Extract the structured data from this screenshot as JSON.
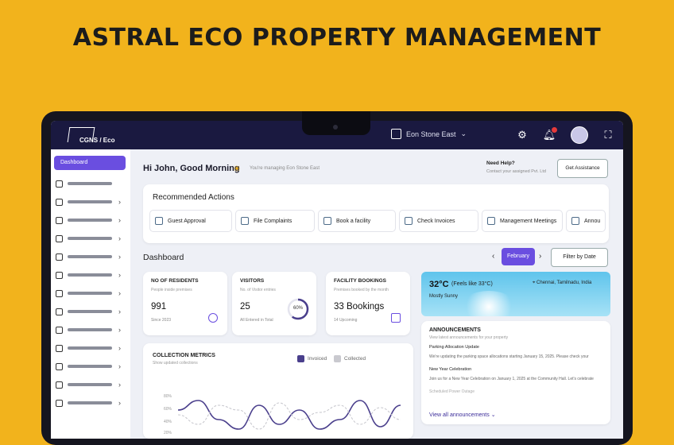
{
  "headline": "ASTRAL ECO PROPERTY MANAGEMENT",
  "brand": {
    "logo_text": "CGNS / Eco"
  },
  "topbar": {
    "property": "Eon Stone East",
    "icons": [
      "settings-icon",
      "bell-icon",
      "avatar",
      "fullscreen-icon"
    ]
  },
  "sidebar": {
    "active": "Dashboard",
    "items": [
      "home-icon",
      "building-icon",
      "users-icon",
      "globe-icon",
      "card-icon",
      "wallet-icon",
      "tag-icon",
      "cycle-icon",
      "document-icon",
      "book-icon",
      "share-icon",
      "gear-icon"
    ]
  },
  "greeting": {
    "title": "Hi John, Good Morning",
    "subtitle": "You're managing Eon Stone East"
  },
  "help": {
    "title": "Need Help?",
    "subtitle": "Contact your assigned Pvt. Ltd",
    "button": "Get Assistance"
  },
  "recommended": {
    "title": "Recommended Actions",
    "actions": [
      "Guest Approval",
      "File Complaints",
      "Book a facility",
      "Check Invoices",
      "Management Meetings",
      "Annou"
    ]
  },
  "dashboard": {
    "title": "Dashboard",
    "month": "February",
    "filter": "Filter by Date"
  },
  "stats": [
    {
      "title": "NO OF RESIDENTS",
      "subtitle": "People inside premises",
      "value": "991",
      "footer": "Since 2023"
    },
    {
      "title": "VISITORS",
      "subtitle": "No. of Visitor entries",
      "value": "25",
      "footer": "All Entered in Total",
      "ring": "60%"
    },
    {
      "title": "FACILITY BOOKINGS",
      "subtitle": "Premises booked by the month",
      "value": "33 Bookings",
      "footer": "14 Upcoming"
    }
  ],
  "weather": {
    "temp": "32°C",
    "feels": "(Feels like 33°C)",
    "location": "Chennai, Tamilnadu, India",
    "condition": "Mostly Sunny"
  },
  "announcements": {
    "title": "ANNOUNCEMENTS",
    "subtitle": "View latest announcements for your property",
    "items": [
      {
        "title": "Parking Allocation Update",
        "body": "We're updating the parking space allocations starting January 15, 2025. Please check your"
      },
      {
        "title": "New Year Celebration",
        "body": "Join us for a New Year Celebration on January 1, 2025 at the Community Hall. Let's celebrate"
      },
      {
        "title": "Scheduled Power Outage",
        "body": ""
      }
    ],
    "link": "View all announcements"
  },
  "collection": {
    "title": "COLLECTION METRICS",
    "subtitle": "Show updated collections",
    "legend": [
      "Invoiced",
      "Collected"
    ],
    "colors": {
      "invoiced": "#4a3f8c",
      "collected": "#c9c9cf"
    },
    "yticks": [
      "80%",
      "60%",
      "40%",
      "20%"
    ]
  },
  "chart_data": {
    "type": "line",
    "title": "COLLECTION METRICS",
    "series": [
      {
        "name": "Invoiced",
        "values": [
          60,
          80,
          40,
          20,
          70,
          30,
          60,
          20,
          40,
          80,
          25,
          70
        ]
      },
      {
        "name": "Collected",
        "values": [
          50,
          30,
          70,
          60,
          20,
          75,
          40,
          55,
          70,
          30,
          65,
          40
        ]
      }
    ],
    "ylim": [
      0,
      100
    ]
  },
  "accent": "#6a4ee0",
  "topbar_color": "#1a1940",
  "background_color": "#f2b31c"
}
